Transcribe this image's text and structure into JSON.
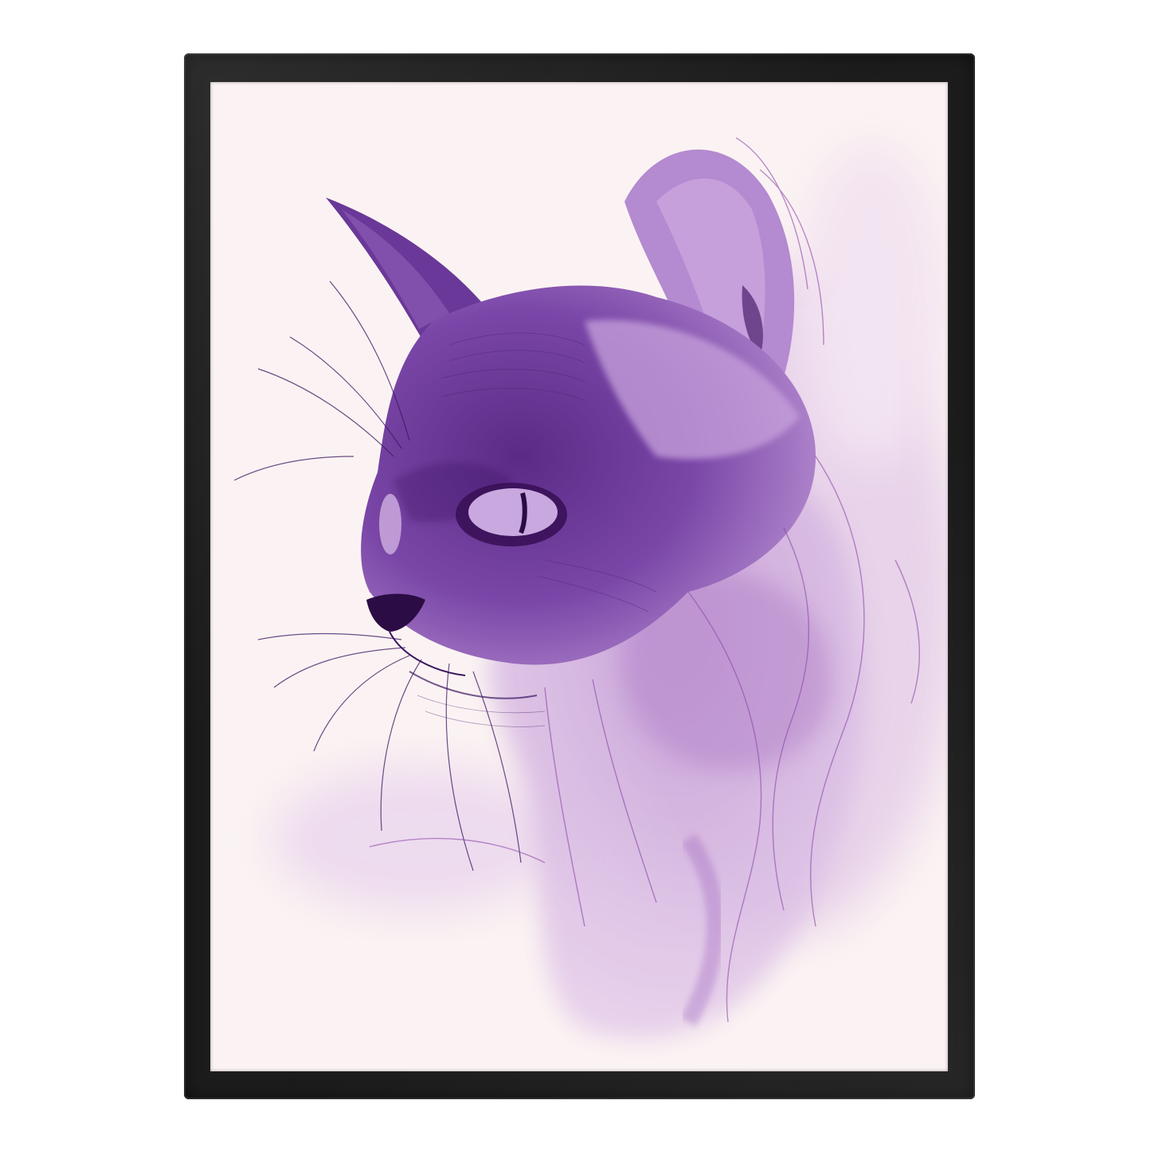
{
  "artwork": {
    "subject": "cat-portrait",
    "medium": "watercolor-and-ink",
    "colors": {
      "frame": "#1c1c1c",
      "paper": "#fbf3f3",
      "wash_dark": "#5b2a86",
      "wash_mid": "#8a5bb8",
      "wash_light": "#cfa7d9",
      "ink": "#3b1560"
    }
  }
}
